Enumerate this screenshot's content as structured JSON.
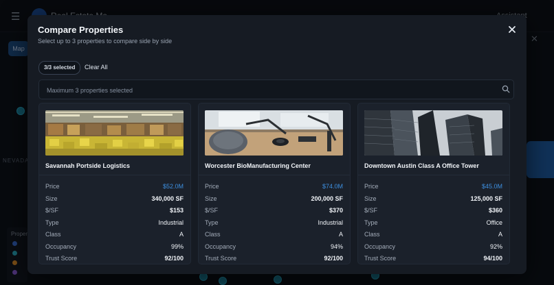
{
  "background": {
    "brand": "Real Estate Ma...",
    "assistant_label": "Assistant",
    "map_button": "Map",
    "region_label": "NEVADA",
    "legend_title": "Proper"
  },
  "modal": {
    "title": "Compare Properties",
    "subtitle": "Select up to 3 properties to compare side by side",
    "selected_badge": "3/3 selected",
    "clear_all": "Clear All",
    "search_placeholder": "Maximum 3 properties selected",
    "metric_labels": [
      "Price",
      "Size",
      "$/SF",
      "Type",
      "Class",
      "Occupancy",
      "Trust Score"
    ],
    "properties": [
      {
        "name": "Savannah Portside Logistics",
        "price": "$52.0M",
        "size": "340,000 SF",
        "price_per_sf": "$153",
        "type": "Industrial",
        "class": "A",
        "occupancy": "99%",
        "trust_score": "92/100",
        "image": "warehouse-photo"
      },
      {
        "name": "Worcester BioManufacturing Center",
        "price": "$74.0M",
        "size": "200,000 SF",
        "price_per_sf": "$370",
        "type": "Industrial",
        "class": "A",
        "occupancy": "94%",
        "trust_score": "92/100",
        "image": "lab-workspace-photo"
      },
      {
        "name": "Downtown Austin Class A Office Tower",
        "price": "$45.0M",
        "size": "125,000 SF",
        "price_per_sf": "$360",
        "type": "Office",
        "class": "A",
        "occupancy": "92%",
        "trust_score": "94/100",
        "image": "office-towers-photo"
      }
    ]
  },
  "colors": {
    "accent_price": "#3d8fe0",
    "modal_bg": "#161b23",
    "card_bg": "#1b212b"
  }
}
